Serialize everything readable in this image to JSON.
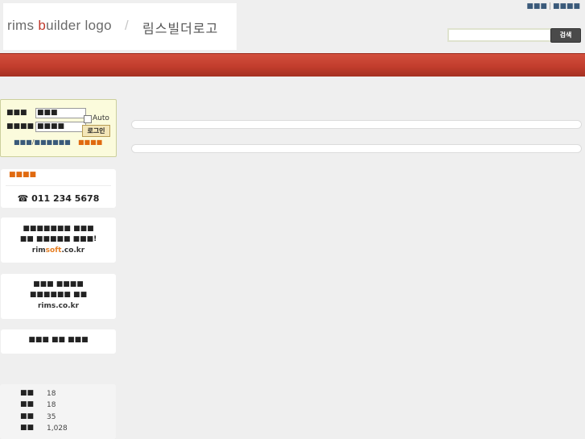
{
  "header": {
    "logo_en_prefix": "rims ",
    "logo_en_accent": "b",
    "logo_en_rest": "uilder logo",
    "logo_slash": "/",
    "logo_kr": "림스빌더로고",
    "top_links": [
      "■■■",
      "■■■■"
    ],
    "top_link_separator": "|",
    "search": {
      "value": "",
      "button_label": "검색"
    }
  },
  "login": {
    "id_label": "■■■",
    "pw_label": "■■■■",
    "id_value": "■■■",
    "pw_value": "■■■■",
    "auto_label": "Auto",
    "login_button": "로그인",
    "find_id": "■■■",
    "find_separator": "/",
    "find_pw": "■■■■■■",
    "join": "■■■■"
  },
  "phone": {
    "title": "■■■■",
    "icon": "☎",
    "number": "011 234 5678"
  },
  "promo_a": {
    "line1": "■■■■■■■ ■■■",
    "line2": "■■ ■■■■■ ■■■!",
    "domain_prefix": "rim",
    "domain_accent": "soft",
    "domain_suffix": ".co.kr"
  },
  "promo_b": {
    "line1": "■■■ ■■■■",
    "line2": "■■■■■■ ■■",
    "domain": "rims.co.kr"
  },
  "promo_c": {
    "line1": "■■■ ■■ ■■■"
  },
  "stats": [
    {
      "label": "■■",
      "value": "18"
    },
    {
      "label": "■■",
      "value": "18"
    },
    {
      "label": "■■",
      "value": "35"
    },
    {
      "label": "■■",
      "value": "1,028"
    }
  ],
  "colors": {
    "nav_red": "#c23d2d",
    "orange_accent": "#e06a10",
    "link_blue": "#3a5a7a"
  }
}
